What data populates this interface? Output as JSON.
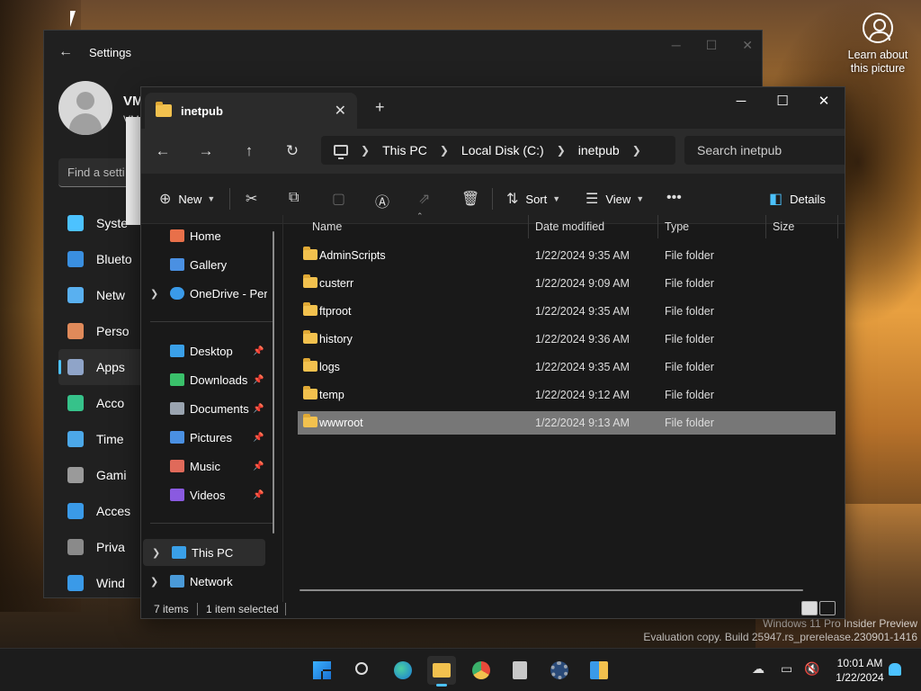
{
  "desktop": {
    "learn_about": "Learn about this picture",
    "watermark_line1": "Windows 11 Pro Insider Preview",
    "watermark_line2": "Evaluation copy. Build 25947.rs_prerelease.230901-1416"
  },
  "settings": {
    "title": "Settings",
    "user_name": "VM",
    "user_sub": "VM",
    "find_placeholder": "Find a setti",
    "nav": [
      {
        "label": "Syste",
        "icon": "system-icon",
        "color": "#4cc2ff"
      },
      {
        "label": "Blueto",
        "icon": "bluetooth-icon",
        "color": "#3a8fe0"
      },
      {
        "label": "Netw",
        "icon": "wifi-icon",
        "color": "#59b0f0"
      },
      {
        "label": "Perso",
        "icon": "brush-icon",
        "color": "#e08a5a"
      },
      {
        "label": "Apps",
        "icon": "apps-icon",
        "color": "#8fa4c8"
      },
      {
        "label": "Acco",
        "icon": "account-icon",
        "color": "#36c28a"
      },
      {
        "label": "Time",
        "icon": "clock-icon",
        "color": "#4ca8e8"
      },
      {
        "label": "Gami",
        "icon": "gamepad-icon",
        "color": "#9a9a9a"
      },
      {
        "label": "Acces",
        "icon": "accessibility-icon",
        "color": "#3a9ae8"
      },
      {
        "label": "Priva",
        "icon": "shield-icon",
        "color": "#8a8a8a"
      },
      {
        "label": "Wind",
        "icon": "update-icon",
        "color": "#3a9ae8"
      }
    ],
    "active_nav": 4
  },
  "explorer": {
    "tab_title": "inetpub",
    "breadcrumb": [
      "This PC",
      "Local Disk (C:)",
      "inetpub"
    ],
    "search_placeholder": "Search inetpub",
    "commands": {
      "new": "New",
      "sort": "Sort",
      "view": "View",
      "details": "Details"
    },
    "nav": {
      "home": "Home",
      "gallery": "Gallery",
      "onedrive": "OneDrive - Perso",
      "quick": [
        {
          "label": "Desktop",
          "icon": "desktop-icon",
          "color": "#3aa0e8"
        },
        {
          "label": "Downloads",
          "icon": "download-icon",
          "color": "#3ac06a"
        },
        {
          "label": "Documents",
          "icon": "documents-icon",
          "color": "#9aa4b0"
        },
        {
          "label": "Pictures",
          "icon": "pictures-icon",
          "color": "#4a90e2"
        },
        {
          "label": "Music",
          "icon": "music-icon",
          "color": "#e06a5a"
        },
        {
          "label": "Videos",
          "icon": "videos-icon",
          "color": "#8a5ae0"
        }
      ],
      "this_pc": "This PC",
      "network": "Network"
    },
    "columns": [
      "Name",
      "Date modified",
      "Type",
      "Size"
    ],
    "rows": [
      {
        "name": "AdminScripts",
        "date": "1/22/2024 9:35 AM",
        "type": "File folder"
      },
      {
        "name": "custerr",
        "date": "1/22/2024 9:09 AM",
        "type": "File folder"
      },
      {
        "name": "ftproot",
        "date": "1/22/2024 9:35 AM",
        "type": "File folder"
      },
      {
        "name": "history",
        "date": "1/22/2024 9:36 AM",
        "type": "File folder"
      },
      {
        "name": "logs",
        "date": "1/22/2024 9:35 AM",
        "type": "File folder"
      },
      {
        "name": "temp",
        "date": "1/22/2024 9:12 AM",
        "type": "File folder"
      },
      {
        "name": "wwwroot",
        "date": "1/22/2024 9:13 AM",
        "type": "File folder"
      }
    ],
    "selected_row": 6,
    "status": {
      "count": "7 items",
      "selected": "1 item selected"
    }
  },
  "taskbar": {
    "time": "10:01 AM",
    "date": "1/22/2024",
    "pinned": [
      "start-icon",
      "search-icon",
      "edge-icon",
      "file-explorer-icon",
      "chrome-icon",
      "notepad-icon",
      "settings-icon",
      "app-icon"
    ]
  }
}
